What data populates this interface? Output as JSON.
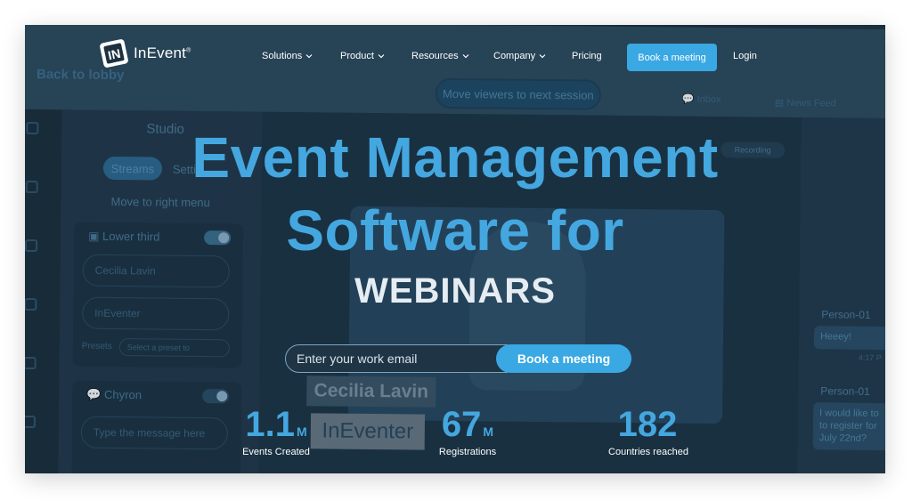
{
  "background_ui": {
    "back_link": "Back to lobby",
    "move_viewers": "Move viewers to next session",
    "inbox": "Inbox",
    "news_feed": "News Feed",
    "studio_title": "Studio",
    "tab_streams": "Streams",
    "tab_settings": "Setti",
    "move_to_right": "Move to right menu",
    "lower_third": "Lower third",
    "field_name": "Cecilia Lavin",
    "field_company": "InEventer",
    "presets_label": "Presets",
    "preset_select": "Select a preset to",
    "chyron": "Chyron",
    "chyron_placeholder": "Type the message here",
    "recording": "Recording",
    "lower_name": "Cecilia Lavin",
    "lower_company": "InEventer",
    "chat": {
      "sender1": "Person-01",
      "msg1": "Heeey!",
      "time1": "4:17 P",
      "sender2": "Person-01",
      "msg2": "I would like to to register for July 22nd?"
    }
  },
  "brand": {
    "name": "InEvent",
    "reg": "®"
  },
  "nav": {
    "items": [
      "Solutions",
      "Product",
      "Resources",
      "Company"
    ],
    "pricing": "Pricing",
    "book": "Book a meeting",
    "login": "Login"
  },
  "hero": {
    "line1": "Event Management",
    "line2": "Software for",
    "line3": "WEBINARS",
    "email_placeholder": "Enter your work email",
    "cta": "Book a meeting"
  },
  "stats": [
    {
      "value": "1.1",
      "unit": "M",
      "label": "Events Created"
    },
    {
      "value": "67",
      "unit": "M",
      "label": "Registrations"
    },
    {
      "value": "182",
      "unit": "",
      "label": "Countries reached"
    }
  ],
  "colors": {
    "accent": "#39a8e3",
    "hero_text": "#44a7df",
    "dark_bg": "#1d3140"
  }
}
